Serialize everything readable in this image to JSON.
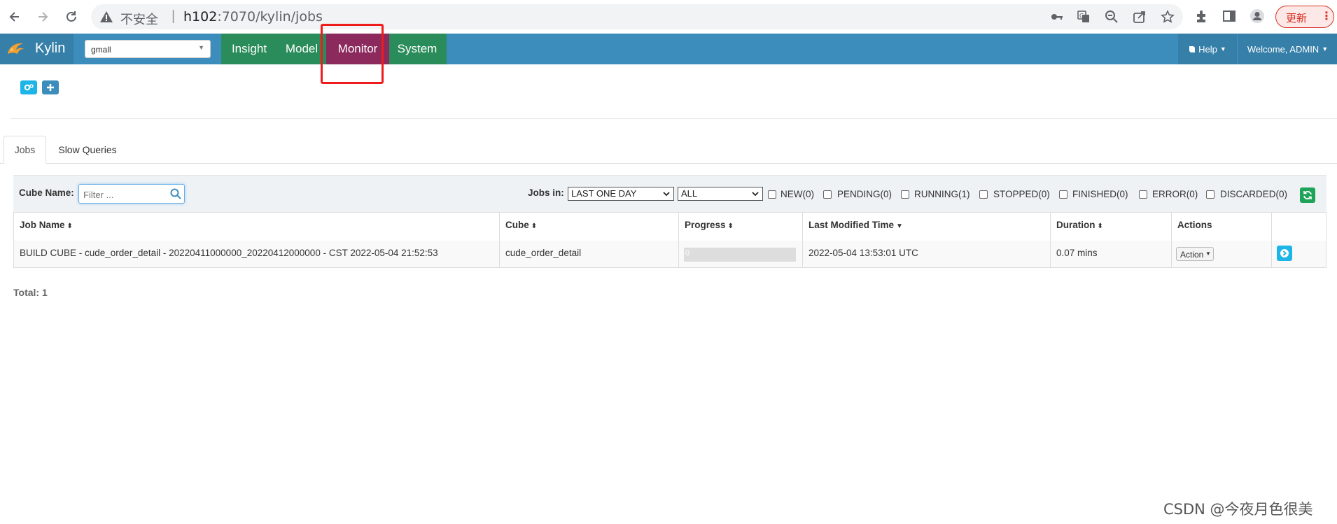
{
  "browser": {
    "insecure_label": "不安全",
    "url_host": "h102",
    "url_rest": ":7070/kylin/jobs",
    "update_label": "更新",
    "menu_glyph": "⋮"
  },
  "navbar": {
    "brand": "Kylin",
    "project": "gmall",
    "menu": [
      "Insight",
      "Model",
      "Monitor",
      "System"
    ],
    "active_menu": "Monitor",
    "help_label": "Help",
    "welcome_label": "Welcome, ADMIN",
    "colors": {
      "navbar": "#3c8dbc",
      "menu_bg": "#2a8c5a",
      "active": "#8c2a5e",
      "highlight": "#ee1c1c"
    }
  },
  "tabs": [
    "Jobs",
    "Slow Queries"
  ],
  "filters": {
    "cube_name_label": "Cube Name:",
    "cube_name_placeholder": "Filter ...",
    "jobs_in_label": "Jobs in:",
    "period": "LAST ONE DAY",
    "status_scope": "ALL",
    "statuses": [
      "NEW(0)",
      "PENDING(0)",
      "RUNNING(1)",
      "STOPPED(0)",
      "FINISHED(0)",
      "ERROR(0)",
      "DISCARDED(0)"
    ]
  },
  "table": {
    "headers": [
      "Job Name",
      "Cube",
      "Progress",
      "Last Modified Time",
      "Duration",
      "Actions"
    ],
    "rows": [
      {
        "job_name": "BUILD CUBE - cude_order_detail - 20220411000000_20220412000000 - CST 2022-05-04 21:52:53",
        "cube": "cude_order_detail",
        "progress": "0",
        "last_modified": "2022-05-04 13:53:01 UTC",
        "duration": "0.07 mins",
        "action_label": "Action"
      }
    ]
  },
  "total_label": "Total: 1",
  "watermark": "CSDN @今夜月色很美"
}
